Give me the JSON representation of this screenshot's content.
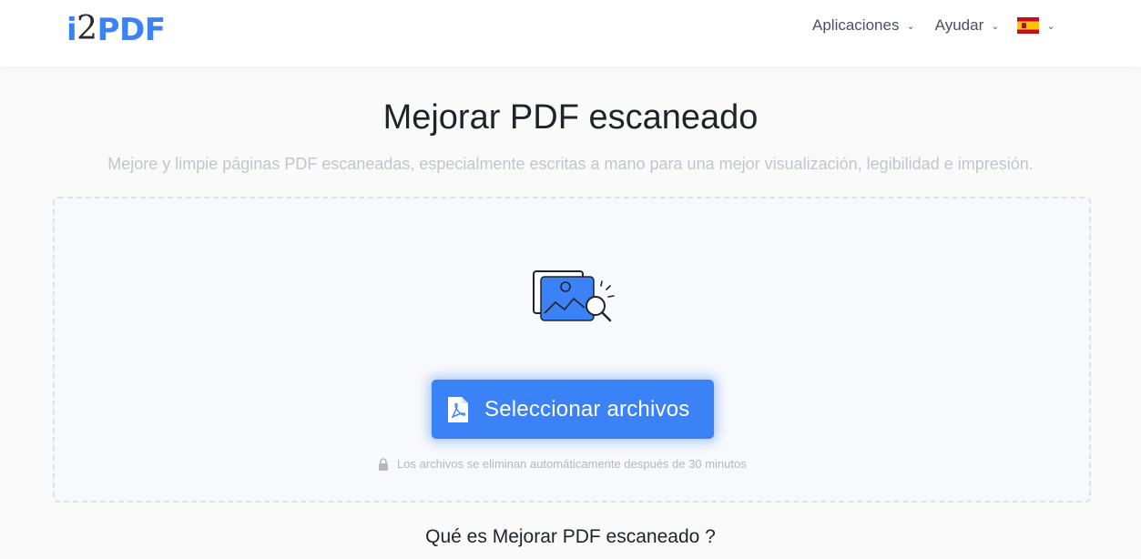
{
  "header": {
    "logo": {
      "part_i": "i",
      "part_2": "2",
      "part_pdf": "PDF"
    },
    "nav": {
      "apps_label": "Aplicaciones",
      "help_label": "Ayudar",
      "language_icon": "spain-flag-icon"
    }
  },
  "main": {
    "title": "Mejorar PDF escaneado",
    "subtitle": "Mejore y limpie páginas PDF escaneadas, especialmente escritas a mano para una mejor visualización, legibilidad e impresión.",
    "dropzone": {
      "illustration_icon": "image-magnifier-icon",
      "select_button_label": "Seleccionar archivos",
      "select_button_icon": "pdf-file-icon",
      "privacy_note": "Los archivos se eliminan automáticamente después de 30 minutos",
      "privacy_icon": "lock-icon"
    },
    "section_heading": "Qué es Mejorar PDF escaneado ?"
  },
  "colors": {
    "accent": "#3b82f6",
    "title_text": "#1f2429",
    "muted_text": "#c2c5cc"
  }
}
